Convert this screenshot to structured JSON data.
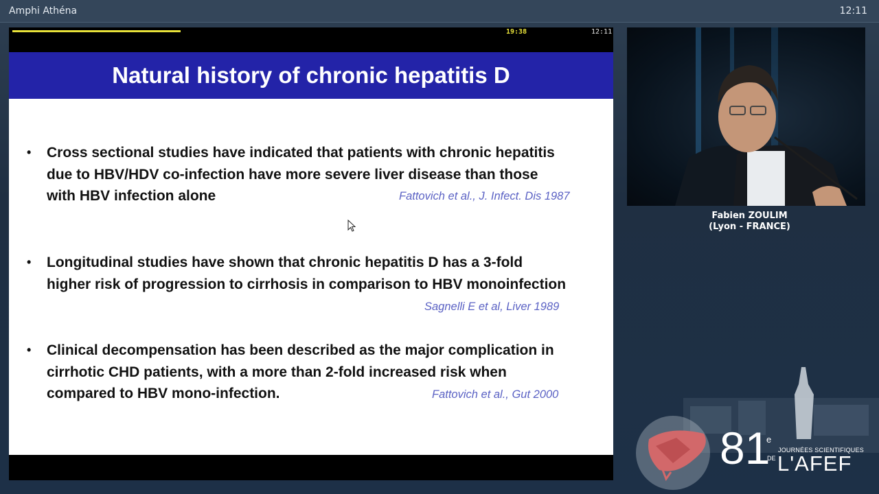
{
  "window": {
    "title": "Amphi Athéna",
    "clock": "12:11"
  },
  "slide_status": {
    "elapsed": "19:38",
    "clock": "12:11"
  },
  "slide": {
    "title": "Natural history of chronic hepatitis D",
    "bullets": [
      {
        "lines": [
          "Cross sectional studies have indicated that patients with chronic hepatitis",
          "due to HBV/HDV co-infection have more severe liver disease than those",
          "with HBV infection alone"
        ],
        "reference": "Fattovich et al., J. Infect. Dis 1987"
      },
      {
        "lines": [
          "Longitudinal studies have shown that chronic hepatitis D has a 3-fold",
          "higher risk of progression to cirrhosis in comparison to HBV monoinfection"
        ],
        "reference": "Sagnelli E et al, Liver 1989"
      },
      {
        "lines": [
          "Clinical decompensation has been described as the major complication in",
          "cirrhotic CHD patients, with a more than 2-fold increased risk when",
          "compared to HBV mono-infection."
        ],
        "reference": "Fattovich et al.,  Gut 2000"
      }
    ],
    "bullet_glyph": "•"
  },
  "speaker": {
    "name": "Fabien ZOULIM",
    "location": "(Lyon - FRANCE)"
  },
  "logo": {
    "number": "81",
    "superscript": "e",
    "line1": "JOURNÉES SCIENTIFIQUES",
    "de": "DE",
    "org": "L'AFEF"
  },
  "colors": {
    "title_band": "#2323a8",
    "reference": "#5b62c4",
    "progress": "#e8e23a"
  }
}
